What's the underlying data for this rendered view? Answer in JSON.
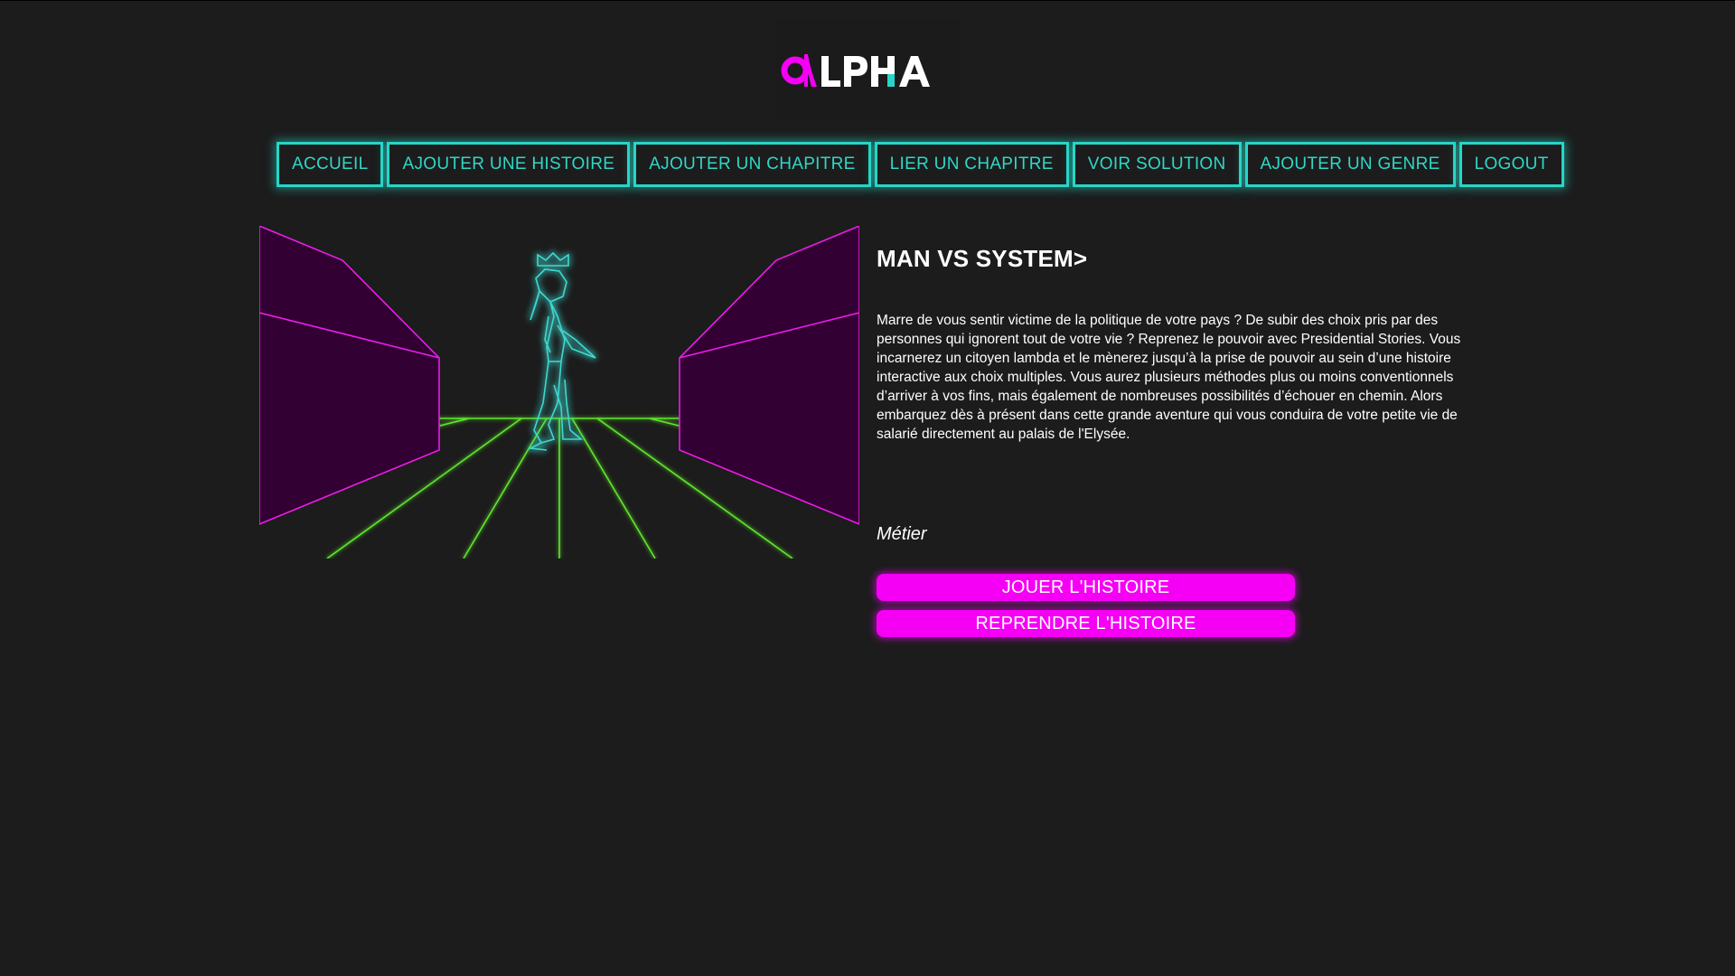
{
  "logo": {
    "text_alpha_glyph": "α",
    "text_rest": "LPHA",
    "accent": "#f500f5",
    "secondary": "#ffffff"
  },
  "nav": {
    "items": [
      {
        "label": "ACCUEIL"
      },
      {
        "label": "AJOUTER UNE HISTOIRE"
      },
      {
        "label": "AJOUTER UN CHAPITRE"
      },
      {
        "label": "LIER UN CHAPITRE"
      },
      {
        "label": "VOIR SOLUTION"
      },
      {
        "label": "AJOUTER UN GENRE"
      },
      {
        "label": "LOGOUT"
      }
    ],
    "color": "#27d6c6"
  },
  "story": {
    "title": "MAN VS SYSTEM>",
    "description": "Marre de vous sentir victime de la politique de votre pays ? De subir des choix pris par des personnes qui ignorent tout de votre vie ? Reprenez le pouvoir avec Presidential Stories. Vous incarnerez un citoyen lambda et le mènerez jusqu’à la prise de pouvoir au sein d’une histoire interactive aux choix multiples. Vous aurez plusieurs méthodes plus ou moins conventionnels d’arriver à vos fins, mais également de nombreuses possibilités d’échouer en chemin. Alors embarquez dès à présent dans cette grande aventure qui vous conduira de votre petite vie de salarié directement au palais de l'Elysée.",
    "genre": "Métier",
    "play_label": "JOUER L'HISTOIRE",
    "resume_label": "REPRENDRE L'HISTOIRE"
  },
  "colors": {
    "background": "#1c1c1c",
    "neon_magenta": "#f500f5",
    "neon_cyan": "#27d6c6",
    "neon_green": "#5ee82c",
    "wall_fill": "#330033"
  }
}
